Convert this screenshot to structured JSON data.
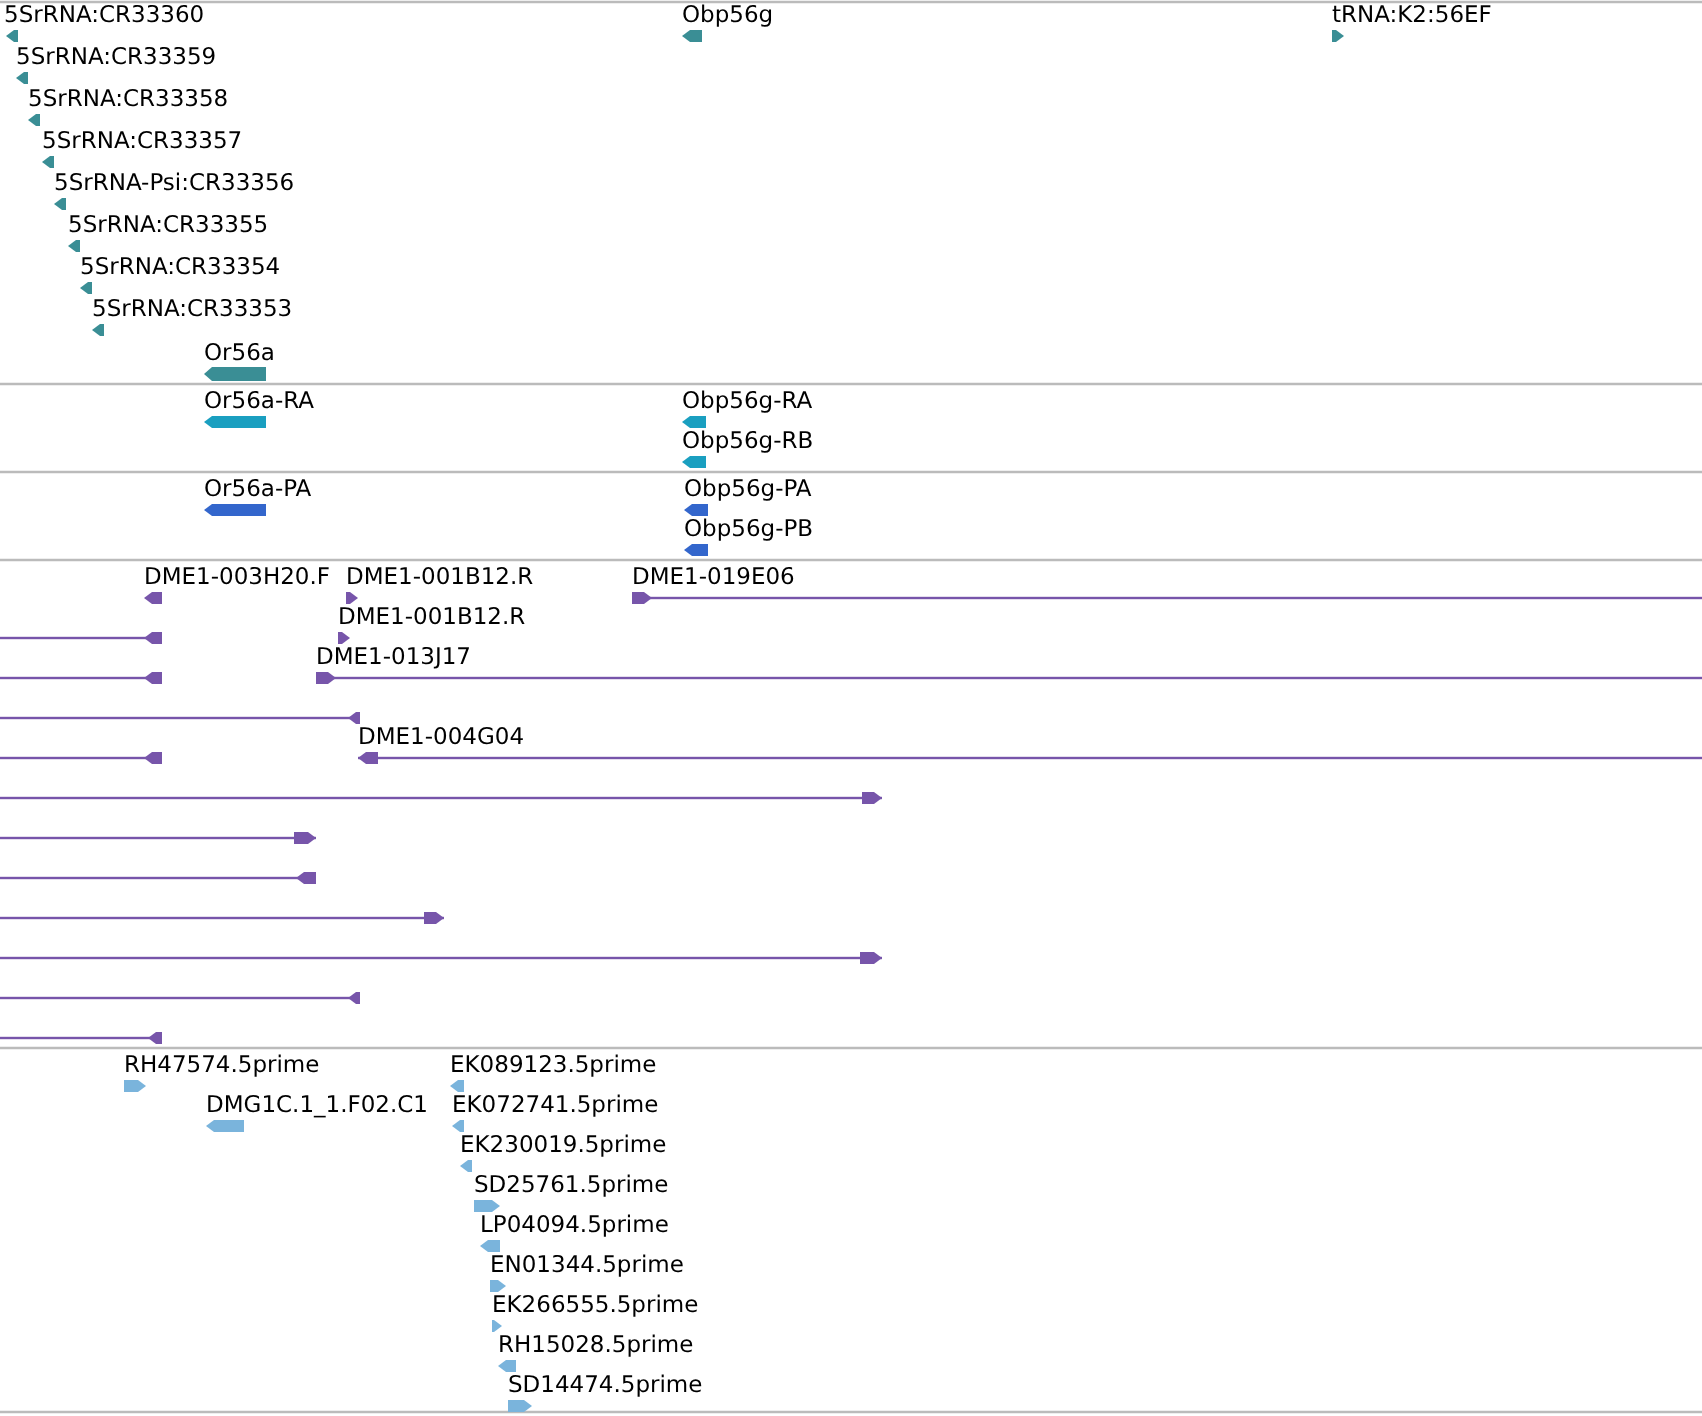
{
  "tracks": [
    {
      "color": "#3a8e95",
      "features": [
        {
          "label": "5SrRNA:CR33360",
          "reverse": true
        },
        {
          "label": "5SrRNA:CR33359",
          "reverse": true
        },
        {
          "label": "5SrRNA:CR33358",
          "reverse": true
        },
        {
          "label": "5SrRNA:CR33357",
          "reverse": true
        },
        {
          "label": "5SrRNA-Psi:CR33356",
          "reverse": true
        },
        {
          "label": "5SrRNA:CR33355",
          "reverse": true
        },
        {
          "label": "5SrRNA:CR33354",
          "reverse": true
        },
        {
          "label": "5SrRNA:CR33353",
          "reverse": true
        },
        {
          "label": "Or56a",
          "reverse": true
        },
        {
          "label": "Obp56g",
          "reverse": true
        },
        {
          "label": "tRNA:K2:56EF",
          "reverse": false
        }
      ]
    },
    {
      "color": "#1a9fc0",
      "features": [
        {
          "label": "Or56a-RA",
          "reverse": true
        },
        {
          "label": "Obp56g-RA",
          "reverse": true
        },
        {
          "label": "Obp56g-RB",
          "reverse": true
        }
      ]
    },
    {
      "color": "#3366cc",
      "features": [
        {
          "label": "Or56a-PA",
          "reverse": true
        },
        {
          "label": "Obp56g-PA",
          "reverse": true
        },
        {
          "label": "Obp56g-PB",
          "reverse": true
        }
      ]
    },
    {
      "color": "#7755aa",
      "features": [
        {
          "label": "DME1-003H20.F",
          "reverse": true
        },
        {
          "label": "DME1-001B12.R",
          "reverse": false
        },
        {
          "label": "DME1-019E06",
          "reverse": false
        },
        {
          "reverse": true
        },
        {
          "label": "DME1-001B12.R",
          "reverse": false
        },
        {
          "reverse": true
        },
        {
          "label": "DME1-013J17",
          "reverse": false
        },
        {
          "reverse": true
        },
        {
          "reverse": true
        },
        {
          "label": "DME1-004G04",
          "reverse": true
        },
        {
          "reverse": false
        },
        {
          "reverse": false
        },
        {
          "reverse": true
        },
        {
          "reverse": false
        },
        {
          "reverse": false
        },
        {
          "reverse": true
        },
        {
          "reverse": true
        }
      ]
    },
    {
      "color": "#7ab4dc",
      "features": [
        {
          "label": "RH47574.5prime",
          "reverse": false
        },
        {
          "label": "DMG1C.1_1.F02.C1",
          "reverse": true
        },
        {
          "label": "EK089123.5prime",
          "reverse": true
        },
        {
          "label": "EK072741.5prime",
          "reverse": true
        },
        {
          "label": "EK230019.5prime",
          "reverse": true
        },
        {
          "label": "SD25761.5prime",
          "reverse": false
        },
        {
          "label": "LP04094.5prime",
          "reverse": true
        },
        {
          "label": "EN01344.5prime",
          "reverse": false
        },
        {
          "label": "EK266555.5prime",
          "reverse": false
        },
        {
          "label": "RH15028.5prime",
          "reverse": true
        },
        {
          "label": "SD14474.5prime",
          "reverse": false
        }
      ]
    }
  ]
}
